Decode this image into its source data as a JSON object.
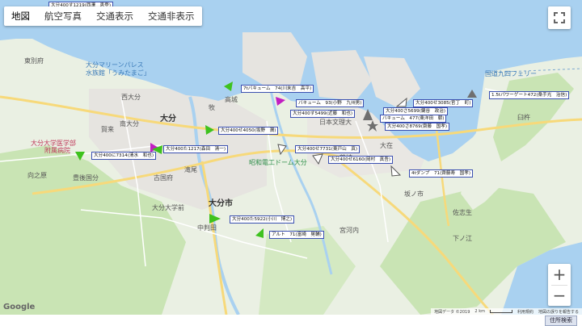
{
  "tabs": [
    {
      "label": "地図",
      "active": true
    },
    {
      "label": "航空写真",
      "active": false
    },
    {
      "label": "交通表示",
      "active": false
    },
    {
      "label": "交通非表示",
      "active": false
    }
  ],
  "places": {
    "oita_city": "大分市",
    "marine_palace": "大分マリーンパレス",
    "marine_palace_sub": "水族館「うみたまご」",
    "higashibetsufu": "東別府",
    "nishioita": "西大分",
    "oita": "大分",
    "takajo": "高城",
    "maki": "牧",
    "oita_univ_hosp": "大分大学医学部",
    "oita_univ_hosp_sub": "附属病院",
    "minami_oita": "南大分",
    "takio": "滝尾",
    "kozuru": "古国府",
    "mukainohara": "向之原",
    "buntoyo": "豊後国分",
    "sekiguchi": "賀来",
    "nishi_oita_park": "大分大学前",
    "showa_denko": "昭和電工ドーム大分",
    "nakahanda": "中判田",
    "saganoseki": "佐志生",
    "shimonoseki": "下ノ江",
    "kunisaki_ferry": "国道九四フェリー",
    "nippon_bunri": "日本文理大",
    "usuki": "臼杵",
    "ozai": "大在",
    "sakanoichi": "坂ノ市",
    "miyako": "宮河内",
    "tsurusaki": "鶴崎"
  },
  "vehicles": [
    {
      "label": "大分400す1219(西澤　恵登)"
    },
    {
      "label": "7tバキューム　74(川末吉　高平)"
    },
    {
      "label": "バキューム　93(小野　九州男)"
    },
    {
      "label": "大分400す5499(近藤　和也)"
    },
    {
      "label": "大分400せ4050(坂野　潤)"
    },
    {
      "label": "大分400に7314(清水　和也)"
    },
    {
      "label": "大分400た1217(森田　清一)"
    },
    {
      "label": "大分400せ7731(東戸山　真)"
    },
    {
      "label": "大分400せ6160(岡村　真吾)"
    },
    {
      "label": "大分400せ3085(官丁　町)"
    },
    {
      "label": "大分400さ5699(鍵谷　政治)"
    },
    {
      "label": "バキューム　477(東洋田　朝)"
    },
    {
      "label": "大分400さ8769(齋藤　国孝)"
    },
    {
      "label": "4tダンプ　71(齊藤寿　国孝)"
    },
    {
      "label": "1.5tパワーゲート472(桑手光　治信)"
    },
    {
      "label": "大分400た5922(小川　博之)"
    },
    {
      "label": "アルト　71(富崎　晃輔)"
    }
  ],
  "google_logo": "Google",
  "attribution": {
    "map_data": "地図データ ©2019",
    "scale": "2 km",
    "terms": "利用規約",
    "report": "地図の誤りを報告する"
  },
  "zoom": {
    "in": "+",
    "out": "−"
  },
  "address_search": "住所検索",
  "colors": {
    "water": "#a9d1f0",
    "land": "#eaf0e3",
    "green": "#c9e4b4",
    "urban": "#e6e4e0",
    "road_major": "#f7d97a",
    "road_minor": "#ffffff",
    "marker_green": "#3ec21e",
    "marker_magenta": "#c21ec2",
    "marker_gray": "#6f6f6f",
    "label_border": "#3a4fb0"
  }
}
